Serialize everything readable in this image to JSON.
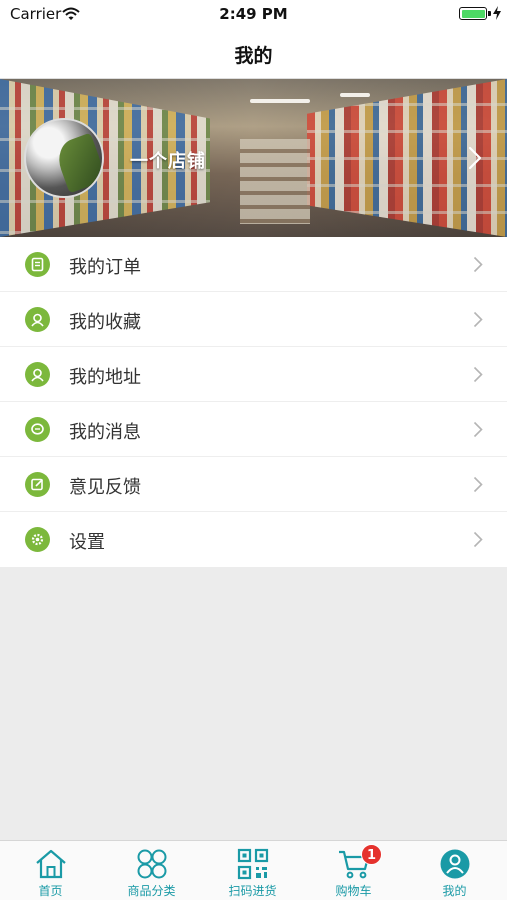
{
  "status_bar": {
    "carrier": "Carrier",
    "time": "2:49 PM",
    "battery_level": 1.0
  },
  "nav": {
    "title": "我的"
  },
  "profile": {
    "shop_name": "一个店铺"
  },
  "menu": [
    {
      "label": "我的订单",
      "icon": "order-icon"
    },
    {
      "label": "我的收藏",
      "icon": "favorites-icon"
    },
    {
      "label": "我的地址",
      "icon": "address-icon"
    },
    {
      "label": "我的消息",
      "icon": "message-icon"
    },
    {
      "label": "意见反馈",
      "icon": "feedback-icon"
    },
    {
      "label": "设置",
      "icon": "settings-icon"
    }
  ],
  "tab_bar": {
    "tabs": [
      {
        "label": "首页",
        "icon": "home-icon"
      },
      {
        "label": "商品分类",
        "icon": "category-icon"
      },
      {
        "label": "扫码进货",
        "icon": "qr-scan-icon"
      },
      {
        "label": "购物车",
        "icon": "cart-icon",
        "badge": "1"
      },
      {
        "label": "我的",
        "icon": "profile-icon",
        "active": true
      }
    ]
  },
  "colors": {
    "accent_green": "#7cb83c",
    "tab_teal": "#1a9aa6",
    "badge_red": "#e5322d",
    "background": "#ececec"
  }
}
